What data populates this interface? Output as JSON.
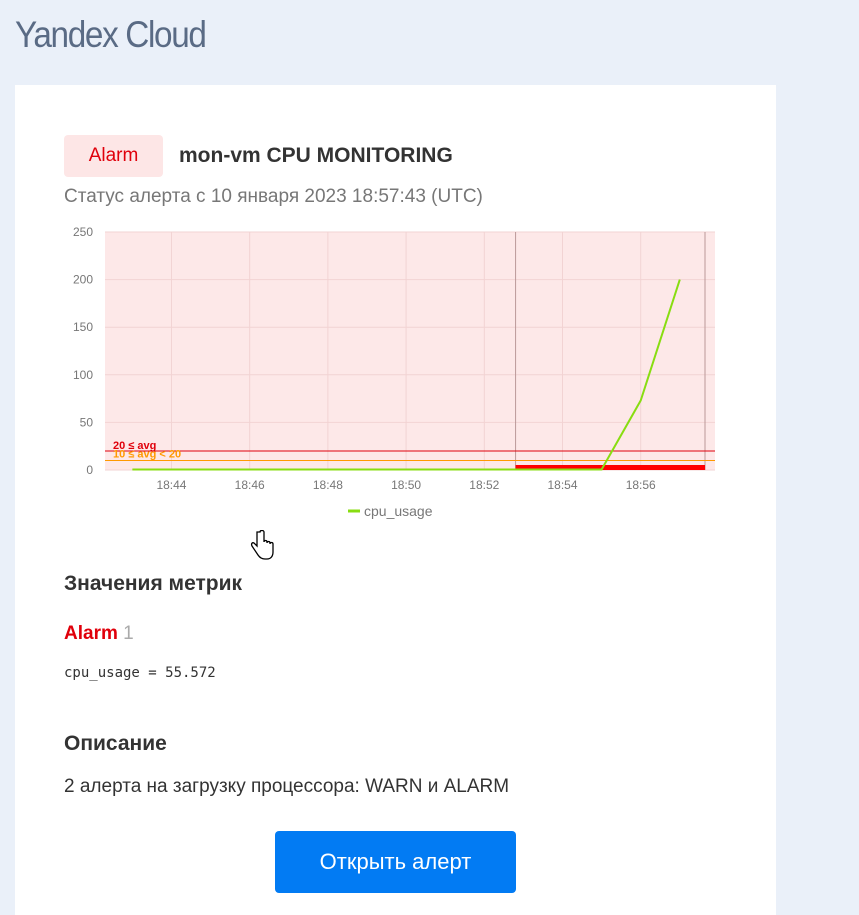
{
  "brand": {
    "name": "Yandex",
    "suffix": "Cloud"
  },
  "alert": {
    "badge": "Alarm",
    "title": "mon-vm CPU MONITORING",
    "status_text": "Статус алерта с 10 января 2023 18:57:43 (UTC)"
  },
  "chart_data": {
    "type": "line",
    "y_ticks": [
      "250",
      "200",
      "150",
      "100",
      "50",
      "0"
    ],
    "ylim": [
      0,
      250
    ],
    "x_ticks": [
      "18:44",
      "18:46",
      "18:48",
      "18:50",
      "18:52",
      "18:54",
      "18:56"
    ],
    "series": [
      {
        "name": "cpu_usage",
        "color": "#88dd11",
        "x": [
          "18:43",
          "18:52.8",
          "18:55",
          "18:56",
          "18:57"
        ],
        "values": [
          0.5,
          0.5,
          0.5,
          73,
          200
        ]
      }
    ],
    "thresholds": [
      {
        "label": "20 ≤ avg",
        "value": 20,
        "color": "#e0000b"
      },
      {
        "label": "10 ≤ avg < 20",
        "value": 10,
        "color": "#ff9900"
      }
    ],
    "alarm_region_start": "18:52.8",
    "legend": "cpu_usage",
    "grid": true
  },
  "metrics": {
    "heading": "Значения метрик",
    "status_label": "Alarm",
    "status_count": "1",
    "line": "cpu_usage = 55.572"
  },
  "description": {
    "heading": "Описание",
    "text": "2 алерта на загрузку процессора: WARN и ALARM"
  },
  "button": {
    "label": "Открыть алерт"
  }
}
